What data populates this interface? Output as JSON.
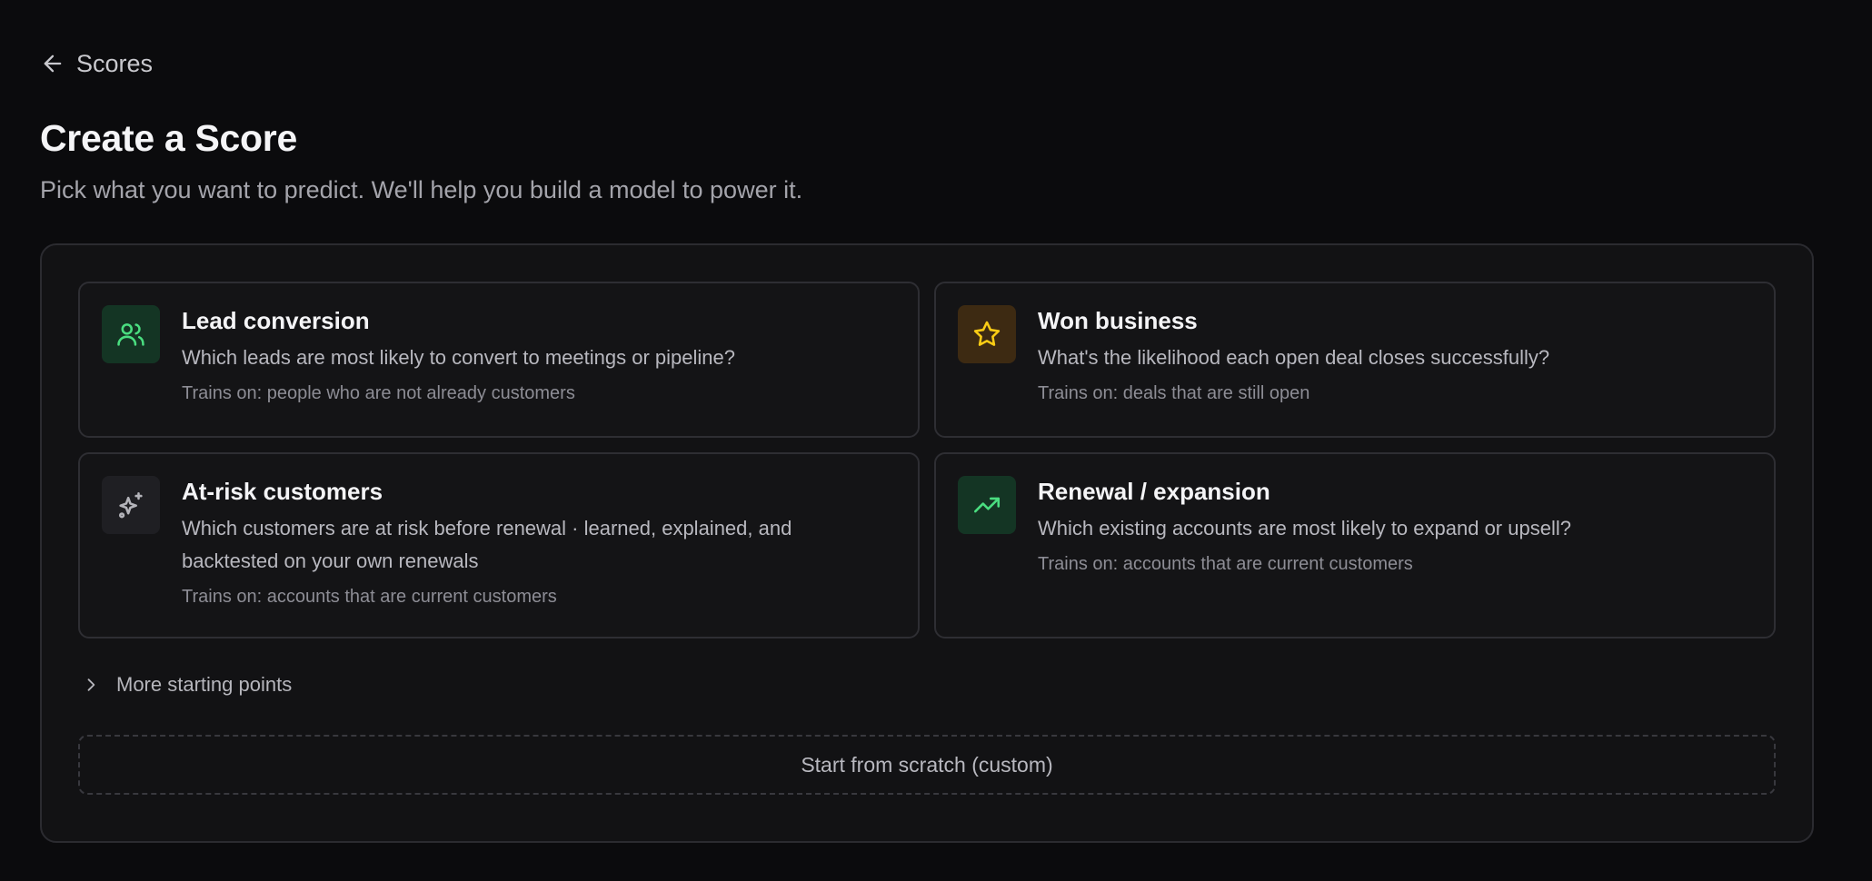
{
  "nav": {
    "back_label": "Scores",
    "back_icon": "arrow-left-icon"
  },
  "header": {
    "title": "Create a Score",
    "subtitle": "Pick what you want to predict. We'll help you build a model to power it."
  },
  "cards": [
    {
      "title": "Lead conversion",
      "description": "Which leads are most likely to convert to meetings or pipeline?",
      "trains_on": "Trains on: people who are not already customers",
      "icon": "users-icon",
      "icon_color": "#4ade80",
      "icon_bg": "#143524"
    },
    {
      "title": "Won business",
      "description": "What's the likelihood each open deal closes successfully?",
      "trains_on": "Trains on: deals that are still open",
      "icon": "star-icon",
      "icon_color": "#facc15",
      "icon_bg": "#3d2a12"
    },
    {
      "title": "At-risk customers",
      "description": "Which customers are at risk before renewal · learned, explained, and backtested on your own renewals",
      "trains_on": "Trains on: accounts that are current customers",
      "icon": "sparkles-icon",
      "icon_color": "#b4b4ba",
      "icon_bg": "#1f1f23"
    },
    {
      "title": "Renewal / expansion",
      "description": "Which existing accounts are most likely to expand or upsell?",
      "trains_on": "Trains on: accounts that are current customers",
      "icon": "trending-up-icon",
      "icon_color": "#4ade80",
      "icon_bg": "#143524"
    }
  ],
  "more": {
    "label": "More starting points",
    "icon": "chevron-right-icon"
  },
  "scratch": {
    "label": "Start from scratch (custom)"
  }
}
